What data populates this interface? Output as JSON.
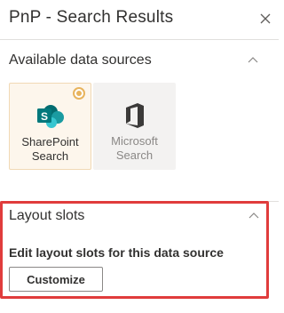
{
  "panel": {
    "title": "PnP - Search Results",
    "close_icon": "close-icon"
  },
  "data_sources": {
    "heading": "Available data sources",
    "options": [
      {
        "label": "SharePoint\nSearch",
        "icon": "sharepoint-icon",
        "selected": true
      },
      {
        "label": "Microsoft\nSearch",
        "icon": "office-icon",
        "selected": false
      }
    ]
  },
  "layout_slots": {
    "heading": "Layout slots",
    "description": "Edit layout slots for this data source",
    "button_label": "Customize"
  },
  "colors": {
    "accent": "#e8b45e",
    "highlight": "#e03c3c",
    "sharepoint": "#036c70",
    "office": "#3b3a39"
  }
}
